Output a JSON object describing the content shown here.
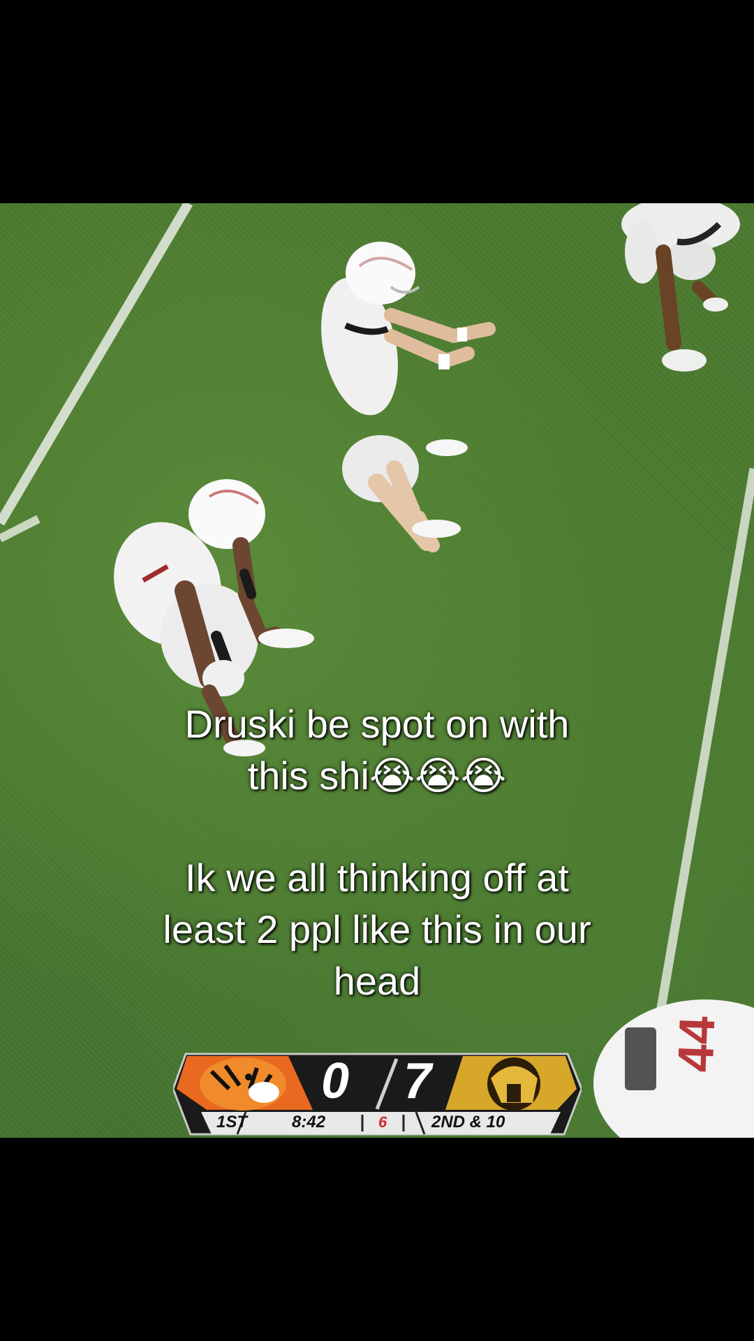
{
  "caption": {
    "line1": "Druski be spot on with",
    "line2": "this shi",
    "emojis": "😭😭😭",
    "line3": "Ik we all thinking off at",
    "line4": "least 2 ppl like this in our",
    "line5": "head"
  },
  "scoreboard": {
    "home_score": "0",
    "away_score": "7",
    "quarter": "1ST",
    "clock": "8:42",
    "flag_number": "6",
    "down_distance": "2ND & 10",
    "home_logo": "tiger-logo",
    "away_logo": "trojan-helmet-logo",
    "home_color": "#e8691f",
    "away_color": "#d6a729"
  },
  "players": {
    "jersey_bottom_right": "44"
  },
  "colors": {
    "field": "#4c7a2f",
    "letterbox": "#000000",
    "caption_text": "#ffffff"
  }
}
